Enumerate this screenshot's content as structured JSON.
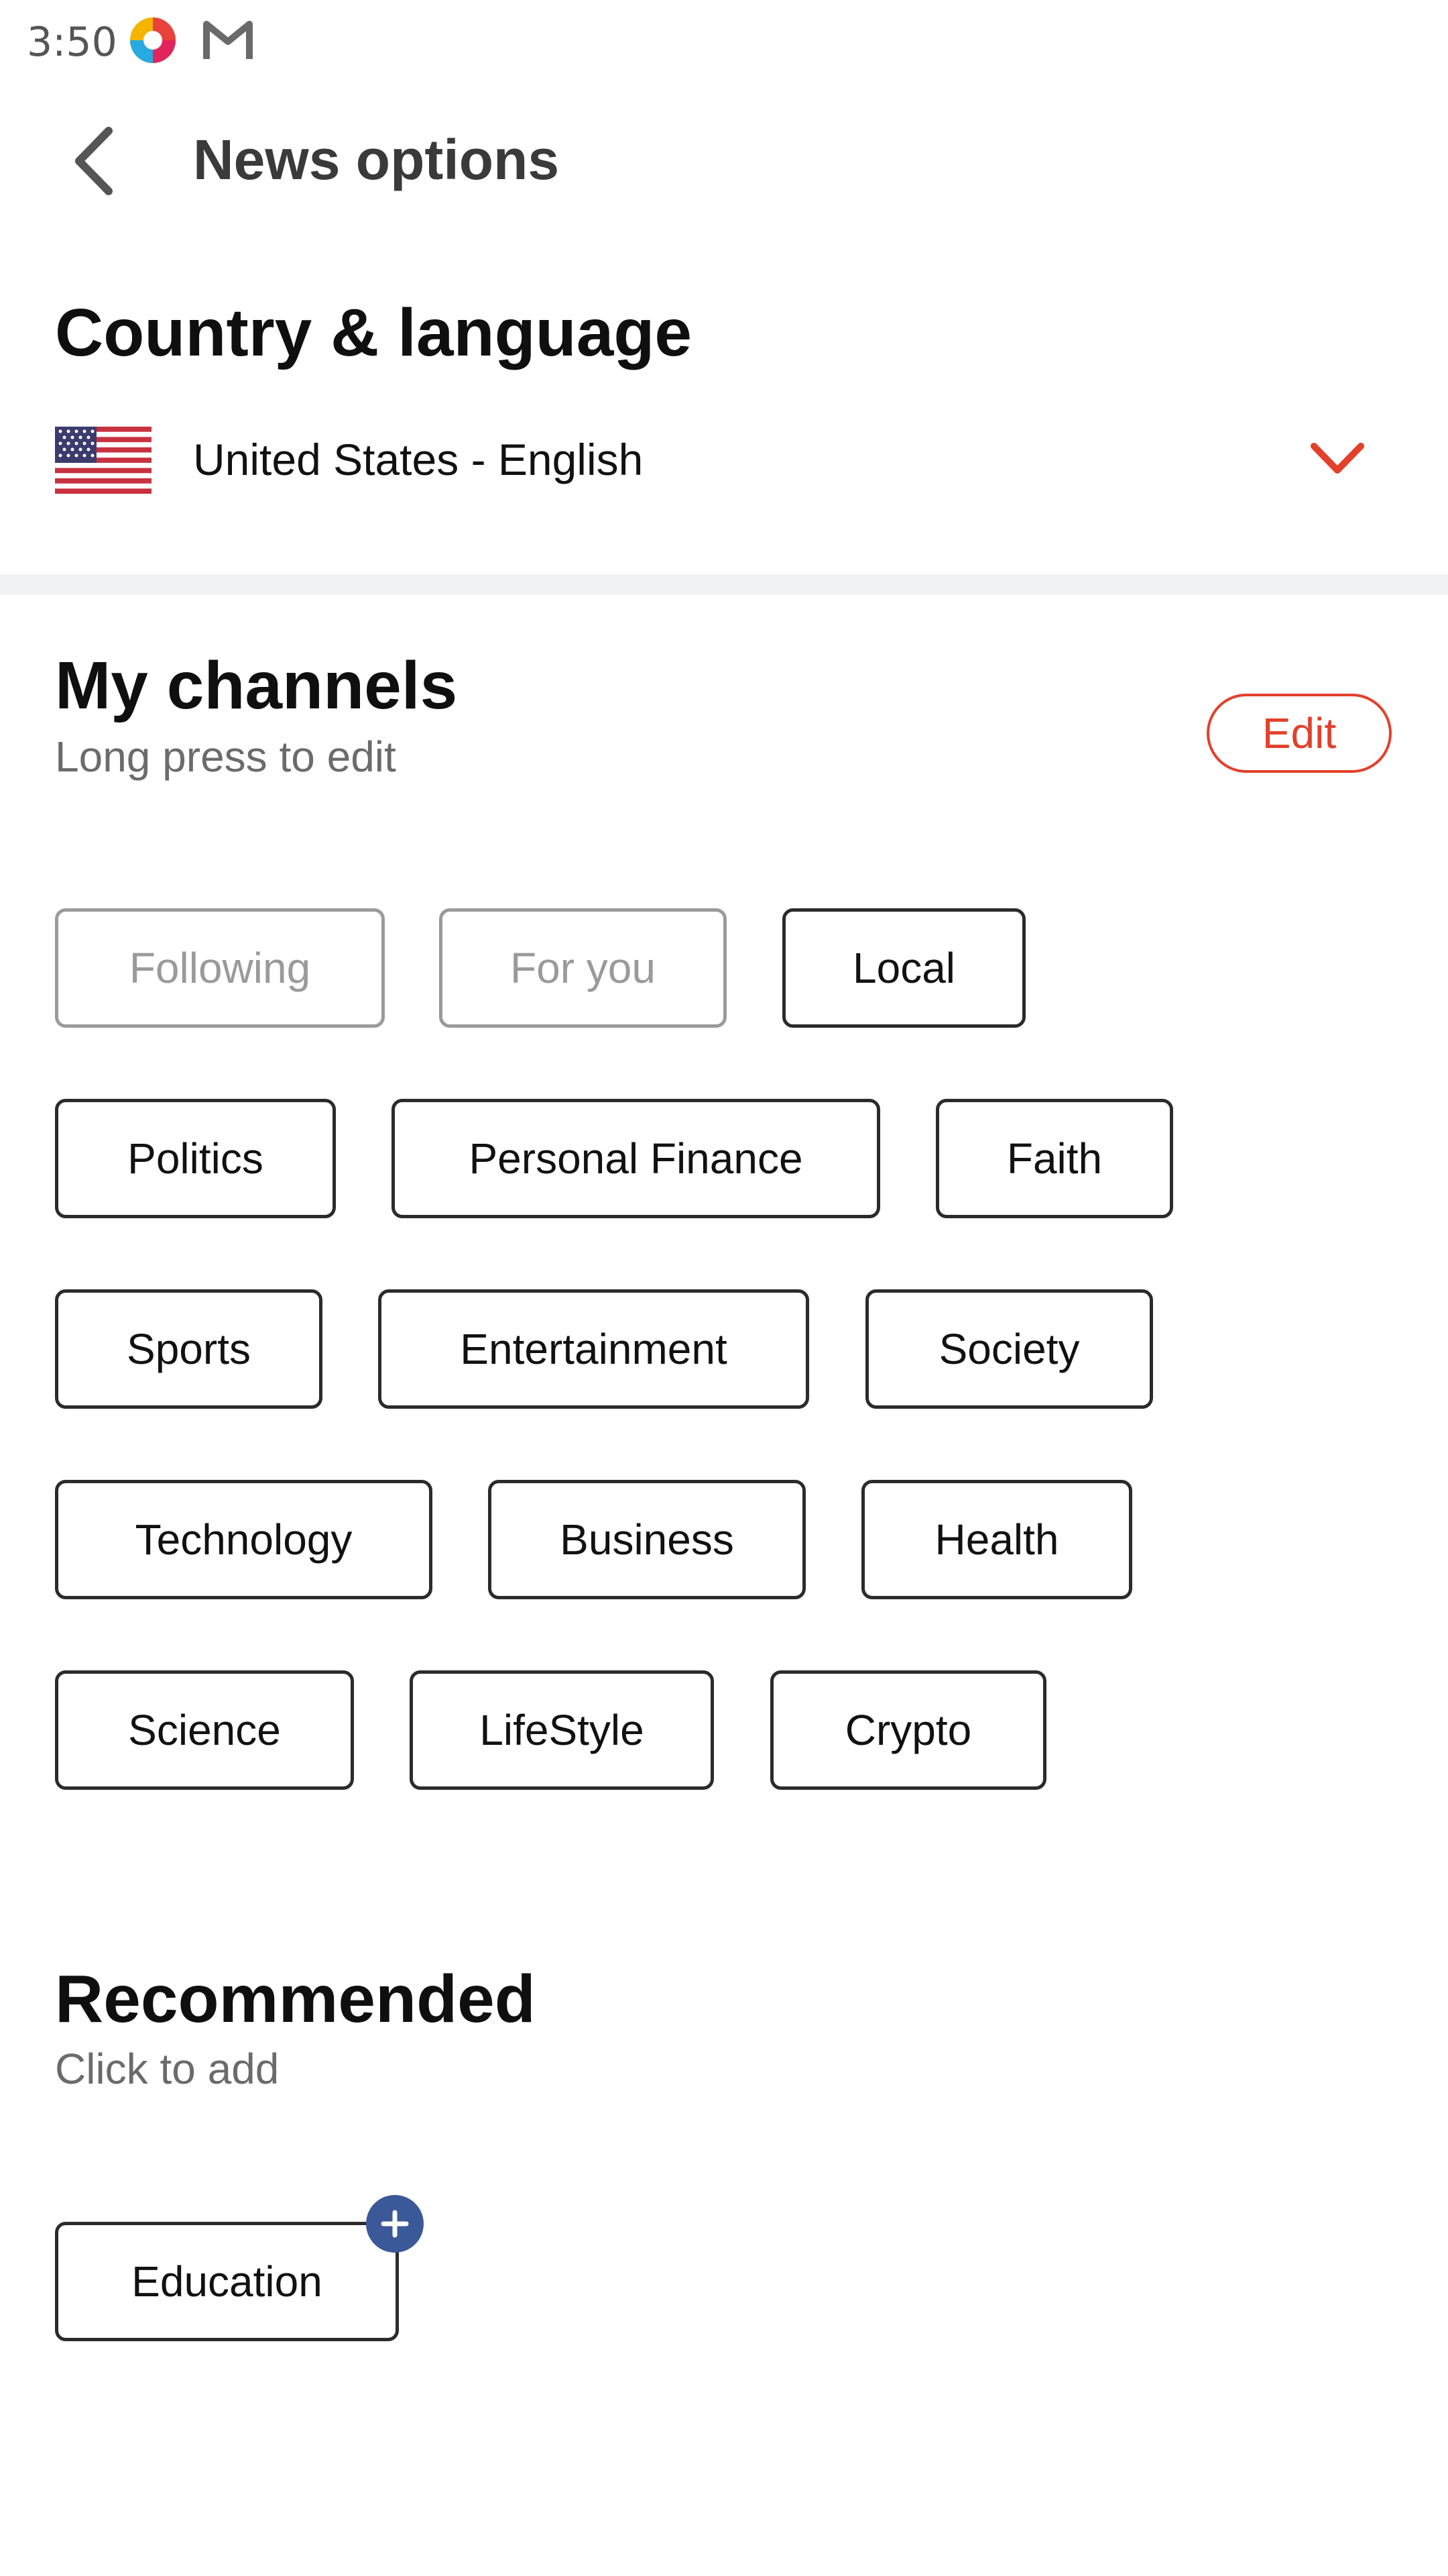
{
  "status_bar": {
    "time": "3:50",
    "icons": [
      "app-swirl-icon",
      "mail-icon"
    ]
  },
  "header": {
    "title": "News options",
    "back_icon": "chevron-left-icon"
  },
  "country_section": {
    "heading": "Country & language",
    "selected": "United States - English",
    "flag_icon": "us-flag-icon",
    "dropdown_icon": "chevron-down-icon"
  },
  "channels_section": {
    "heading": "My channels",
    "subtitle": "Long press to edit",
    "edit_label": "Edit",
    "chips": [
      {
        "label": "Following",
        "muted": true
      },
      {
        "label": "For you",
        "muted": true
      },
      {
        "label": "Local",
        "muted": false
      },
      {
        "label": "Politics",
        "muted": false
      },
      {
        "label": "Personal Finance",
        "muted": false
      },
      {
        "label": "Faith",
        "muted": false
      },
      {
        "label": "Sports",
        "muted": false
      },
      {
        "label": "Entertainment",
        "muted": false
      },
      {
        "label": "Society",
        "muted": false
      },
      {
        "label": "Technology",
        "muted": false
      },
      {
        "label": "Business",
        "muted": false
      },
      {
        "label": "Health",
        "muted": false
      },
      {
        "label": "Science",
        "muted": false
      },
      {
        "label": "LifeStyle",
        "muted": false
      },
      {
        "label": "Crypto",
        "muted": false
      }
    ]
  },
  "recommended_section": {
    "heading": "Recommended",
    "subtitle": "Click to add",
    "chips": [
      {
        "label": "Education",
        "add_icon": "plus-icon"
      }
    ]
  },
  "colors": {
    "accent": "#e3402c",
    "add_badge": "#3b5998",
    "divider": "#f1f2f4"
  }
}
